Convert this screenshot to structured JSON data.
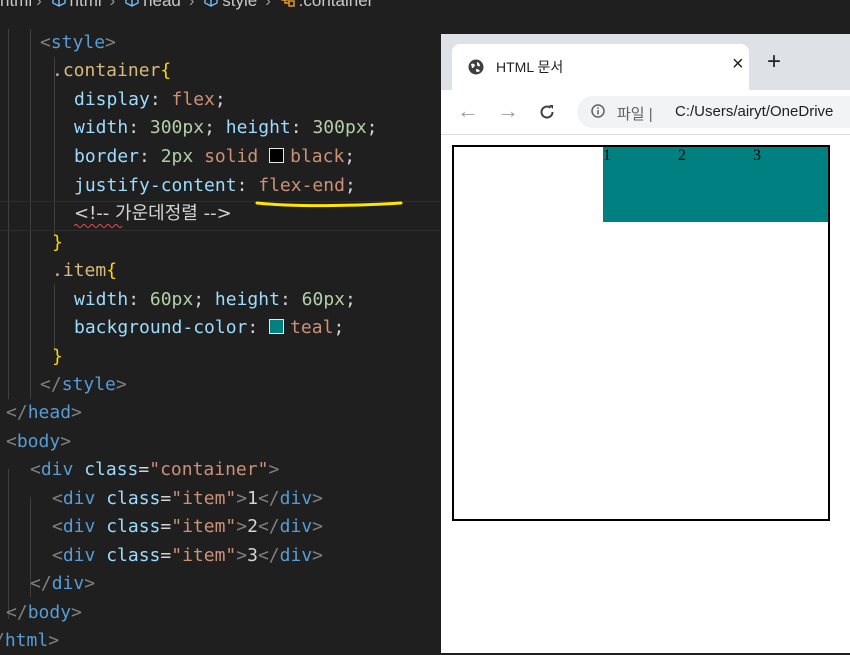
{
  "breadcrumb": {
    "items": [
      "html",
      "html",
      "head",
      "style",
      ".container"
    ]
  },
  "code": {
    "style_open": "style",
    "selector_container": ".container",
    "display_prop": "display",
    "display_val": "flex",
    "width_prop": "width",
    "width_val": "300px",
    "height_prop": "height",
    "height_val": "300px",
    "border_prop": "border",
    "border_w": "2px",
    "border_style": "solid",
    "border_color": "black",
    "justify_prop": "justify-content",
    "justify_val": "flex-end",
    "comment_open": "<!--",
    "comment_text": "가운데정렬",
    "comment_close": "-->",
    "selector_item": ".item",
    "item_width_prop": "width",
    "item_width_val": "60px",
    "item_height_prop": "height",
    "item_height_val": "60px",
    "bg_prop": "background-color",
    "bg_val": "teal",
    "style_close": "style",
    "head_close": "head",
    "body_open": "body",
    "div_tag": "div",
    "class_attr": "class",
    "container_class": "\"container\"",
    "item_class": "\"item\"",
    "item_texts": [
      "1",
      "2",
      "3"
    ],
    "body_close": "body",
    "html_close": "html"
  },
  "browser": {
    "tab_title": "HTML 문서",
    "new_tab": "+",
    "close": "×",
    "omni_label": "파일",
    "omni_sep": "|",
    "url": "C:/Users/airyt/OneDrive"
  },
  "render": {
    "items": [
      "1",
      "2",
      "3"
    ]
  },
  "colors": {
    "editor_bg": "#1f1f1f",
    "teal": "#008080",
    "highlight_underline": "#ffe600"
  }
}
